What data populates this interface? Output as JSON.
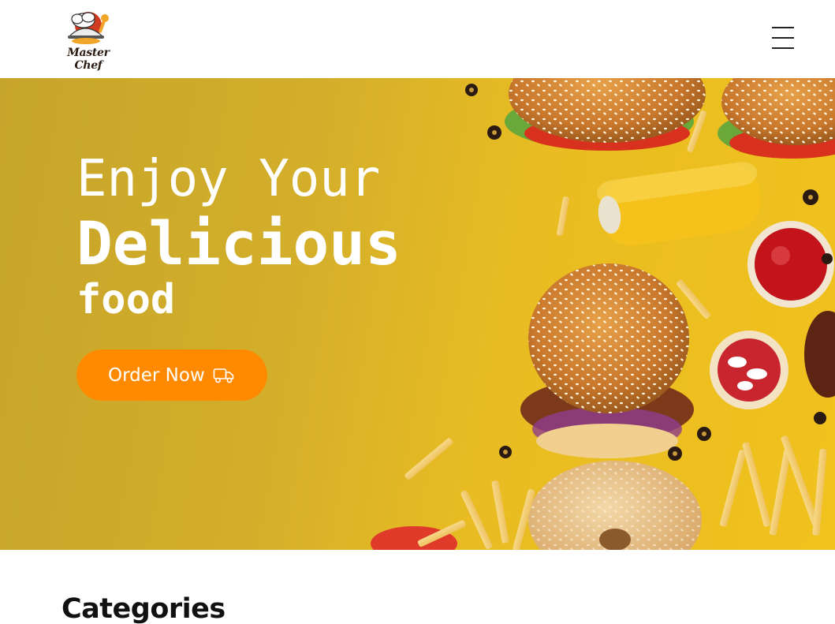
{
  "header": {
    "logo_text": "Master Chef",
    "menu_icon": "hamburger-menu-icon"
  },
  "hero": {
    "line1": "Enjoy Your",
    "line2": "Delicious",
    "line3": "food",
    "cta_label": "Order Now",
    "cta_icon": "delivery-truck-icon",
    "colors": {
      "cta": "#ff8a00",
      "background": "#e8bc22"
    }
  },
  "categories": {
    "title": "Categories"
  }
}
